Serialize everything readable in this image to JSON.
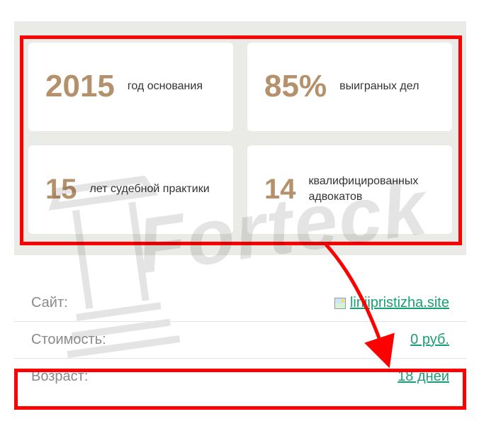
{
  "stats": [
    {
      "number": "2015",
      "label": "год основания"
    },
    {
      "number": "85%",
      "label": "выиграных дел"
    },
    {
      "number": "15",
      "label": "лет судебной практики"
    },
    {
      "number": "14",
      "label": "квалифицированных адвокатов"
    }
  ],
  "info": {
    "site_label": "Сайт:",
    "site_value": "liniipristizha.site",
    "cost_label": "Стоимость:",
    "cost_value": "0 руб.",
    "age_label": "Возраст:",
    "age_value": "18 дней"
  },
  "watermark": "Forteck"
}
